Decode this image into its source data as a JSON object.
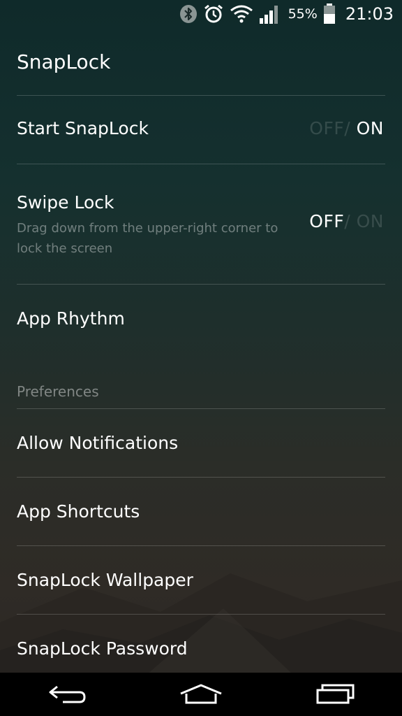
{
  "status_bar": {
    "battery_percent": "55%",
    "time": "21:03",
    "icons": [
      "bluetooth-icon",
      "alarm-icon",
      "wifi-icon",
      "signal-icon",
      "battery-icon"
    ]
  },
  "screen_title": "SnapLock",
  "settings": {
    "start_snaplock": {
      "label": "Start SnapLock",
      "off": "OFF",
      "sep": "/",
      "on": "ON",
      "state": "ON"
    },
    "swipe_lock": {
      "label": "Swipe Lock",
      "description": "Drag down from the upper-right corner to lock the screen",
      "off": "OFF",
      "sep": "/",
      "on": "ON",
      "state": "OFF"
    },
    "app_rhythm": {
      "label": "App Rhythm"
    }
  },
  "preferences": {
    "header": "Preferences",
    "items": [
      {
        "label": "Allow Notifications"
      },
      {
        "label": "App Shortcuts"
      },
      {
        "label": "SnapLock Wallpaper"
      },
      {
        "label": "SnapLock Password"
      }
    ]
  },
  "nav_bar": {
    "buttons": [
      "back-icon",
      "home-icon",
      "recent-apps-icon"
    ]
  },
  "colors": {
    "background_top": "#0f2a2a",
    "background_bottom": "#2b2723",
    "text": "#ffffff",
    "divider": "#3a4644"
  }
}
